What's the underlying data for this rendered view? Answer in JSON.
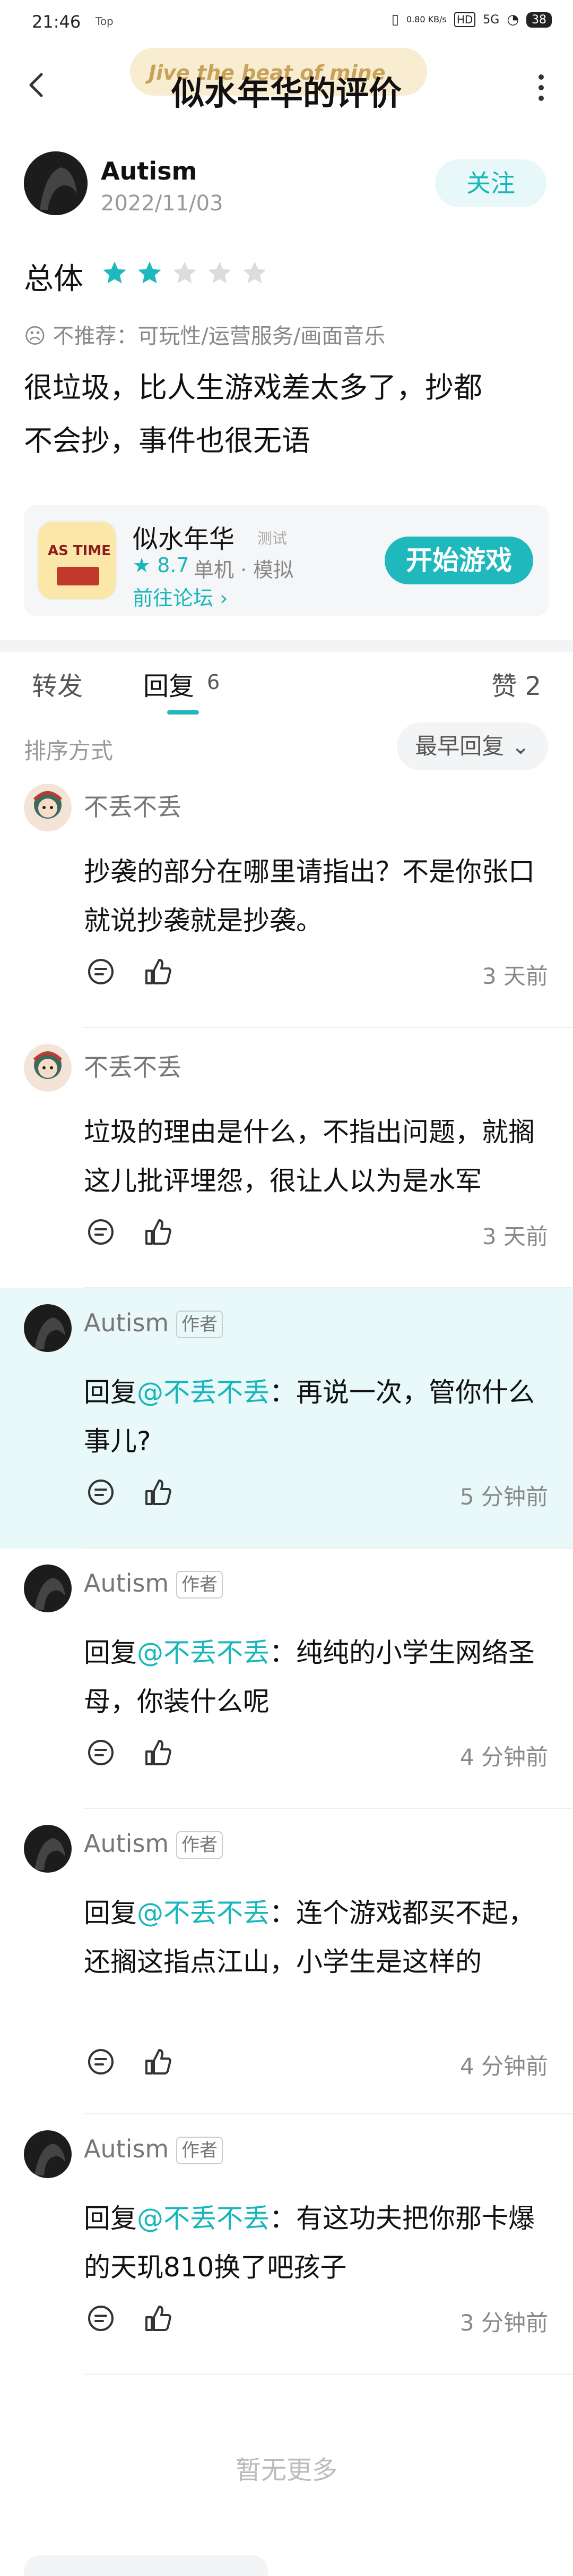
{
  "status_bar": {
    "time": "21:46",
    "app_badge": "Top",
    "network_speed": "0.80 KB/s",
    "hd": "HD",
    "signal": "5G",
    "battery": "38"
  },
  "header": {
    "title": "似水年华的评价",
    "banner_text": "Jive the beat of mine"
  },
  "author": {
    "name": "Autism",
    "date": "2022/11/03",
    "follow_label": "关注"
  },
  "rating": {
    "label": "总体",
    "stars_filled": 2,
    "stars_total": 5,
    "not_recommend": "不推荐：可玩性/运营服务/画面音乐",
    "accent_color": "#1fb9bd"
  },
  "review": {
    "text_line1": "很垃圾，比人生游戏差太多了，抄都",
    "text_line2": "不会抄，事件也很无语"
  },
  "game": {
    "icon_text": "AS TIME",
    "name": "似水年华",
    "tag": "测试",
    "score": "8.7",
    "info": "单机 · 模拟",
    "forum_link": "前往论坛 ›",
    "play_label": "开始游戏"
  },
  "tabs": {
    "forward": "转发",
    "reply": "回复",
    "reply_count": "6",
    "like": "赞 2"
  },
  "sort": {
    "label": "排序方式",
    "selected": "最早回复 ⌄"
  },
  "comments": [
    {
      "name": "不丢不丢",
      "badge": "",
      "reply_prefix": "",
      "mention": "",
      "text": "抄袭的部分在哪里请指出？不是你张口就说抄袭就是抄袭。",
      "time": "3 天前"
    },
    {
      "name": "不丢不丢",
      "badge": "",
      "reply_prefix": "",
      "mention": "",
      "text": "垃圾的理由是什么，不指出问题，就搁这儿批评埋怨，很让人以为是水军",
      "time": "3 天前"
    },
    {
      "name": "Autism",
      "badge": "作者",
      "reply_prefix": "回复",
      "mention": "@不丢不丢",
      "text": "：再说一次，管你什么事儿?",
      "time": "5 分钟前"
    },
    {
      "name": "Autism",
      "badge": "作者",
      "reply_prefix": "回复",
      "mention": "@不丢不丢",
      "text": "：纯纯的小学生网络圣母，你装什么呢",
      "time": "4 分钟前"
    },
    {
      "name": "Autism",
      "badge": "作者",
      "reply_prefix": "回复",
      "mention": "@不丢不丢",
      "text": "：连个游戏都买不起，还搁这指点江山，小学生是这样的",
      "time": "4 分钟前"
    },
    {
      "name": "Autism",
      "badge": "作者",
      "reply_prefix": "回复",
      "mention": "@不丢不丢",
      "text": "：有这功夫把你那卡爆的天玑810换了吧孩子",
      "time": "3 分钟前"
    }
  ],
  "footer": {
    "no_more": "暂无更多"
  }
}
